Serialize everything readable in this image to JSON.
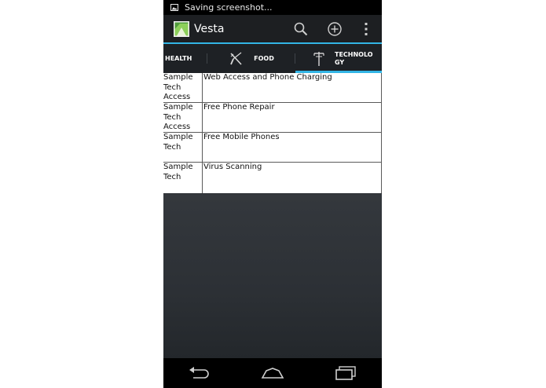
{
  "status_bar": {
    "notification_text": "Saving screenshot...",
    "icon": "image-icon"
  },
  "action_bar": {
    "title": "Vesta",
    "icons": [
      "app-logo-icon",
      "search-icon",
      "add-icon",
      "overflow-menu-icon"
    ],
    "accent_color": "#33b5e5"
  },
  "tabs": [
    {
      "label": "HEALTH",
      "icon": "",
      "selected": false
    },
    {
      "label": "FOOD",
      "icon": "fork-knife-icon",
      "selected": false
    },
    {
      "label": "TECHNOLOGY",
      "icon": "antenna-icon",
      "selected": true
    }
  ],
  "table": {
    "rows": [
      {
        "category": "Sample Tech Access",
        "name": "Web Access and Phone Charging"
      },
      {
        "category": "Sample Tech Access",
        "name": "Free Phone Repair"
      },
      {
        "category": "Sample Tech",
        "name": "Free Mobile Phones"
      },
      {
        "category": "Sample Tech",
        "name": "Virus Scanning"
      }
    ]
  },
  "nav_bar": {
    "icons": [
      "back-icon",
      "home-icon",
      "recent-apps-icon"
    ]
  }
}
